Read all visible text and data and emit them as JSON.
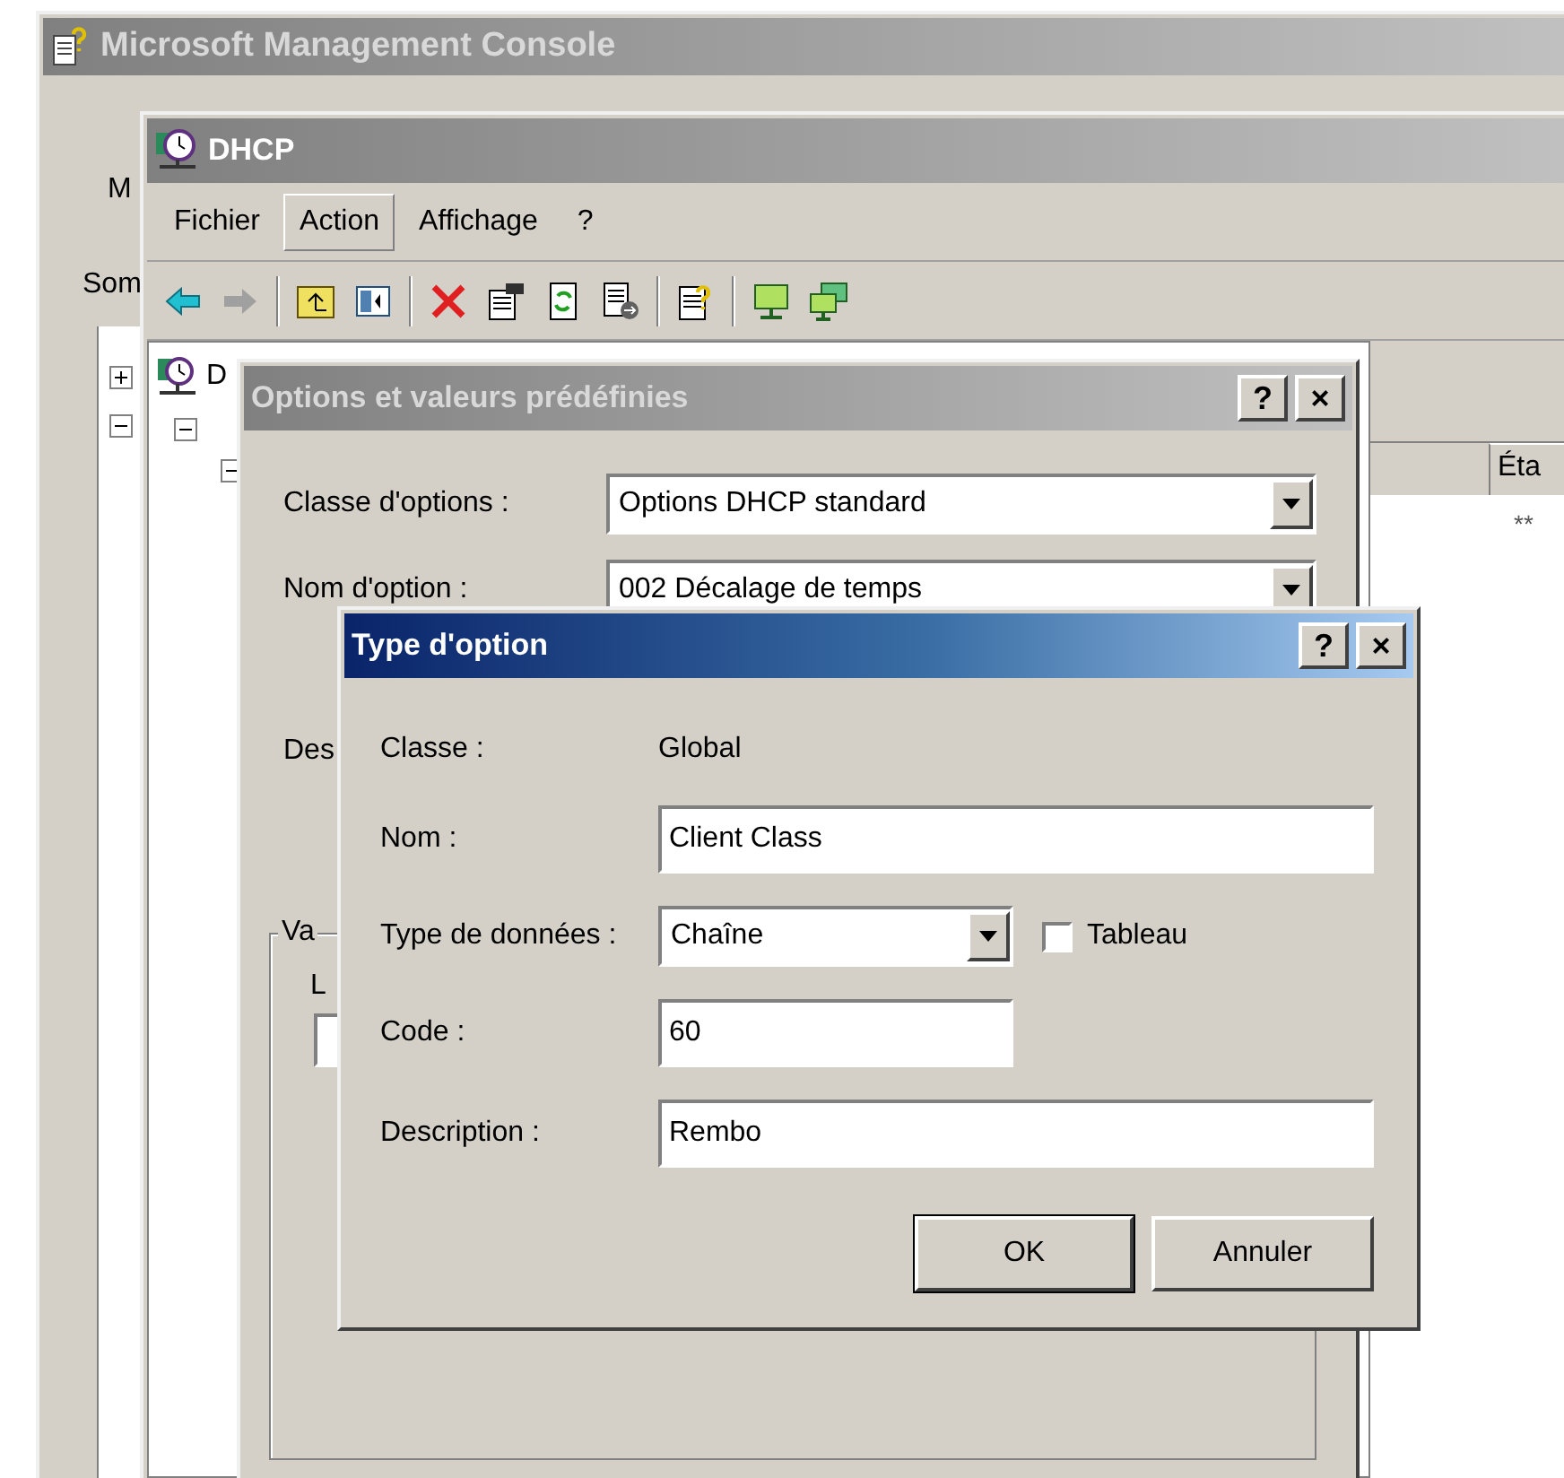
{
  "mmc": {
    "title": "Microsoft Management Console",
    "toolbar_fragment": "M",
    "tab_fragment": "Som",
    "tree_toggles": [
      {
        "expanded": false
      },
      {
        "expanded": true
      }
    ]
  },
  "dhcp": {
    "title": "DHCP",
    "menu": [
      {
        "label": "Fichier",
        "selected": false
      },
      {
        "label": "Action",
        "selected": true
      },
      {
        "label": "Affichage",
        "selected": false
      },
      {
        "label": "?",
        "selected": false
      }
    ],
    "tree": {
      "label": "D",
      "toggles": [
        {
          "expanded": true
        },
        {
          "expanded": true
        }
      ]
    },
    "list": {
      "column": "Éta",
      "cell": "**"
    }
  },
  "options_dialog": {
    "title": "Options et valeurs prédéfinies",
    "help": "?",
    "close": "×",
    "class_label": "Classe d'options :",
    "class_value": "Options DHCP standard",
    "name_label": "Nom d'option :",
    "name_value": "002 Décalage de temps",
    "description_fragment": "Des",
    "group_fragment": "Va",
    "group_label_fragment": "L"
  },
  "type_dialog": {
    "title": "Type d'option",
    "help": "?",
    "close": "×",
    "class_label": "Classe :",
    "class_value": "Global",
    "name_label": "Nom :",
    "name_value": "Client Class",
    "type_label": "Type de données :",
    "type_value": "Chaîne",
    "array": {
      "label": "Tableau",
      "checked": false
    },
    "code_label": "Code :",
    "code_value": "60",
    "description_label": "Description :",
    "description_value": "Rembo",
    "buttons": [
      "OK",
      "Annuler"
    ]
  }
}
